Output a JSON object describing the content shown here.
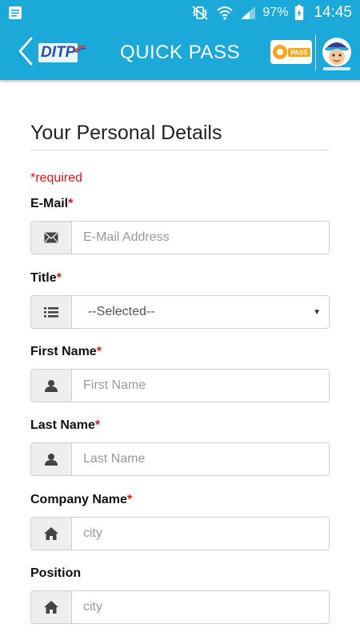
{
  "status_bar": {
    "battery_percent": "97%",
    "time": "14:45"
  },
  "app_bar": {
    "back_logo_text": "DITP",
    "title": "QUICK PASS",
    "qpass_logo_text": "PASS"
  },
  "form": {
    "section_title": "Your Personal Details",
    "required_note": "*required",
    "fields": [
      {
        "label": "E-Mail",
        "required_mark": "*",
        "placeholder": "E-Mail Address",
        "value": "",
        "icon": "envelope-icon"
      },
      {
        "label": "Title",
        "required_mark": "*",
        "selected": "--Selected--",
        "icon": "list-icon"
      },
      {
        "label": "First Name",
        "required_mark": "*",
        "placeholder": "First Name",
        "value": "",
        "icon": "user-icon"
      },
      {
        "label": "Last Name",
        "required_mark": "*",
        "placeholder": "Last Name",
        "value": "",
        "icon": "user-icon"
      },
      {
        "label": "Company Name",
        "required_mark": "*",
        "placeholder": "city",
        "value": "",
        "icon": "home-icon"
      },
      {
        "label": "Position",
        "required_mark": "",
        "placeholder": "city",
        "value": "",
        "icon": "home-icon"
      }
    ]
  },
  "colors": {
    "accent": "#1aa9d8",
    "required": "#e0161b"
  }
}
